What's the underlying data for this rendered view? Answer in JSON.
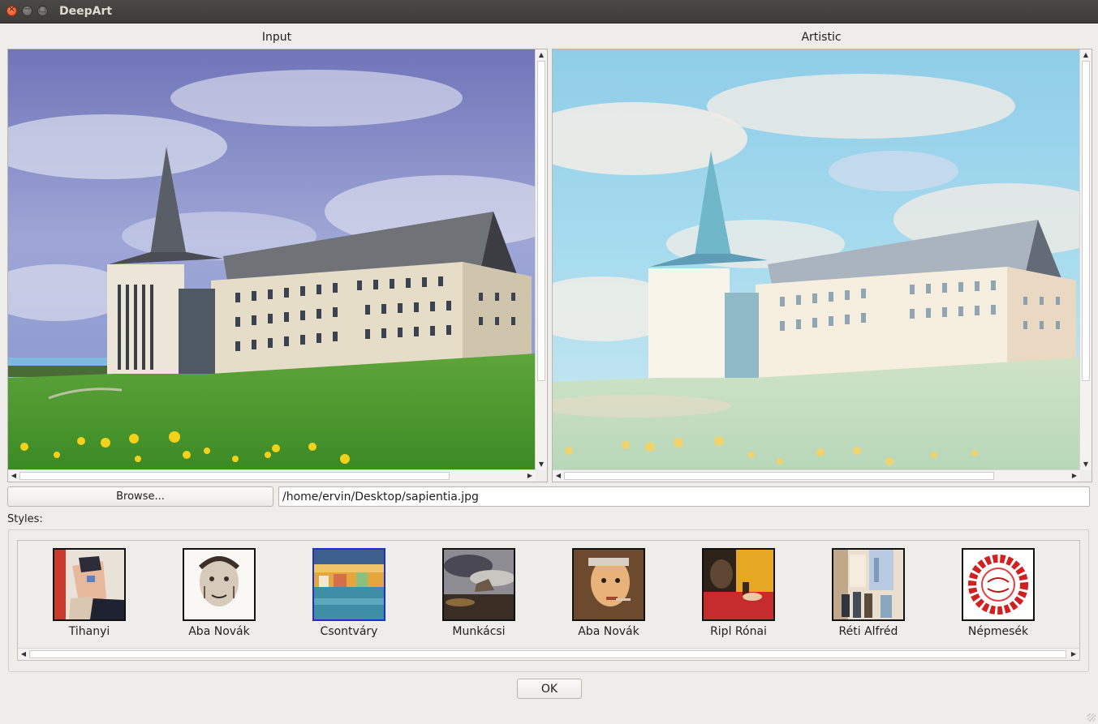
{
  "window": {
    "title": "DeepArt"
  },
  "input_panel": {
    "label": "Input"
  },
  "artistic_panel": {
    "label": "Artistic"
  },
  "browse_button": {
    "label": "Browse..."
  },
  "file_path": {
    "value": "/home/ervin/Desktop/sapientia.jpg"
  },
  "styles": {
    "label": "Styles:",
    "selected": "Csontváry",
    "items": [
      {
        "name": "Tihanyi"
      },
      {
        "name": "Aba Novák"
      },
      {
        "name": "Csontváry"
      },
      {
        "name": "Munkácsi"
      },
      {
        "name": "Aba Novák"
      },
      {
        "name": "Ripl Rónai"
      },
      {
        "name": "Réti Alfréd"
      },
      {
        "name": "Népmesék"
      }
    ]
  },
  "ok_button": {
    "label": "OK"
  },
  "colors": {
    "titlebar": "#3c3b37",
    "window_bg": "#efedea",
    "selection_border": "#1f2fd0",
    "close_button": "#df4b1e"
  }
}
